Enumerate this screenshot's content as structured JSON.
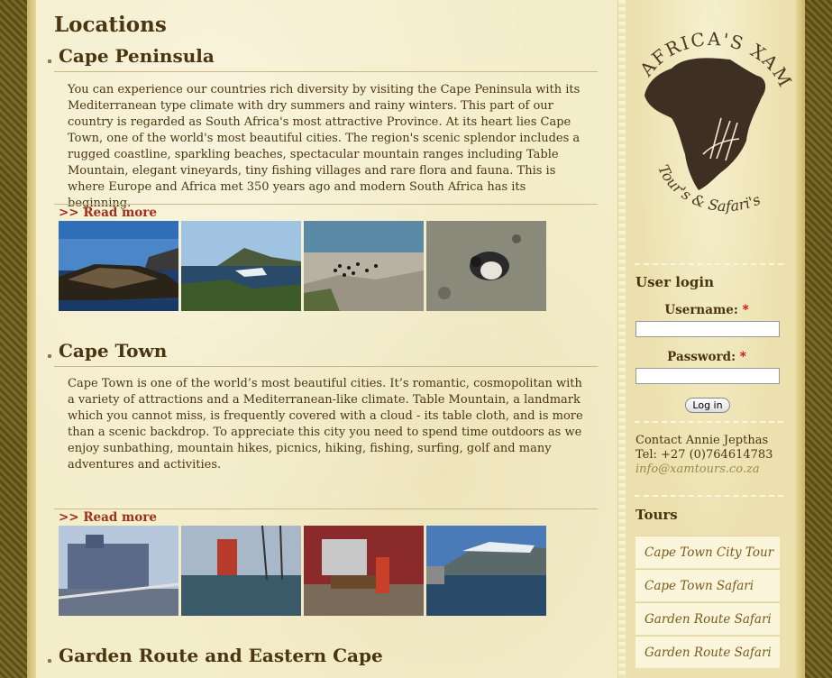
{
  "main": {
    "title": "Locations",
    "sections": [
      {
        "heading": "Cape Peninsula",
        "text": "You can experience our countries rich diversity by visiting the Cape Peninsula with its Mediterranean type climate with dry summers and rainy winters. This part of our country is regarded as South Africa's most attractive Province. At its heart lies Cape Town, one of the world's most beautiful cities. The region's scenic splendor includes a rugged coastline, sparkling beaches, spectacular mountain ranges including Table Mountain, elegant vineyards, tiny fishing villages and rare flora and fauna. This is where Europe and Africa met 350 years ago and modern South Africa has its beginning.",
        "read_more": ">> Read more"
      },
      {
        "heading": "Cape Town",
        "text": "Cape Town is one of the world’s most beautiful cities. It’s romantic, cosmopolitan with a variety of attractions and a Mediterranean-like climate. Table Mountain, a landmark which you cannot miss, is frequently covered with a cloud - its table cloth, and is more than a scenic backdrop. To appreciate this city you need to spend time outdoors as we enjoy sunbathing, mountain hikes, picnics, hiking, fishing, surfing, golf and many adventures and activities.",
        "read_more": ">> Read more"
      },
      {
        "heading": "Garden Route and Eastern Cape"
      }
    ]
  },
  "sidebar": {
    "logo_text_top": "AFRICA'S XAM",
    "logo_text_bottom": "Tour's & Safari's",
    "login": {
      "heading": "User login",
      "username_label": "Username:",
      "password_label": "Password:",
      "required_mark": "*",
      "username_value": "",
      "password_value": "",
      "button": "Log in"
    },
    "contact": {
      "line1": "Contact Annie Jepthas",
      "line2": "Tel: +27 (0)764614783",
      "email": "info@xamtours.co.za"
    },
    "tours": {
      "heading": "Tours",
      "items": [
        "Cape Town City Tour",
        "Cape Town Safari",
        "Garden Route Safari",
        "Garden Route Safari"
      ]
    }
  },
  "colors": {
    "heading": "#4a3511",
    "read_more": "#a0301a",
    "required": "#cc0000",
    "link": "#9a8a4a"
  }
}
